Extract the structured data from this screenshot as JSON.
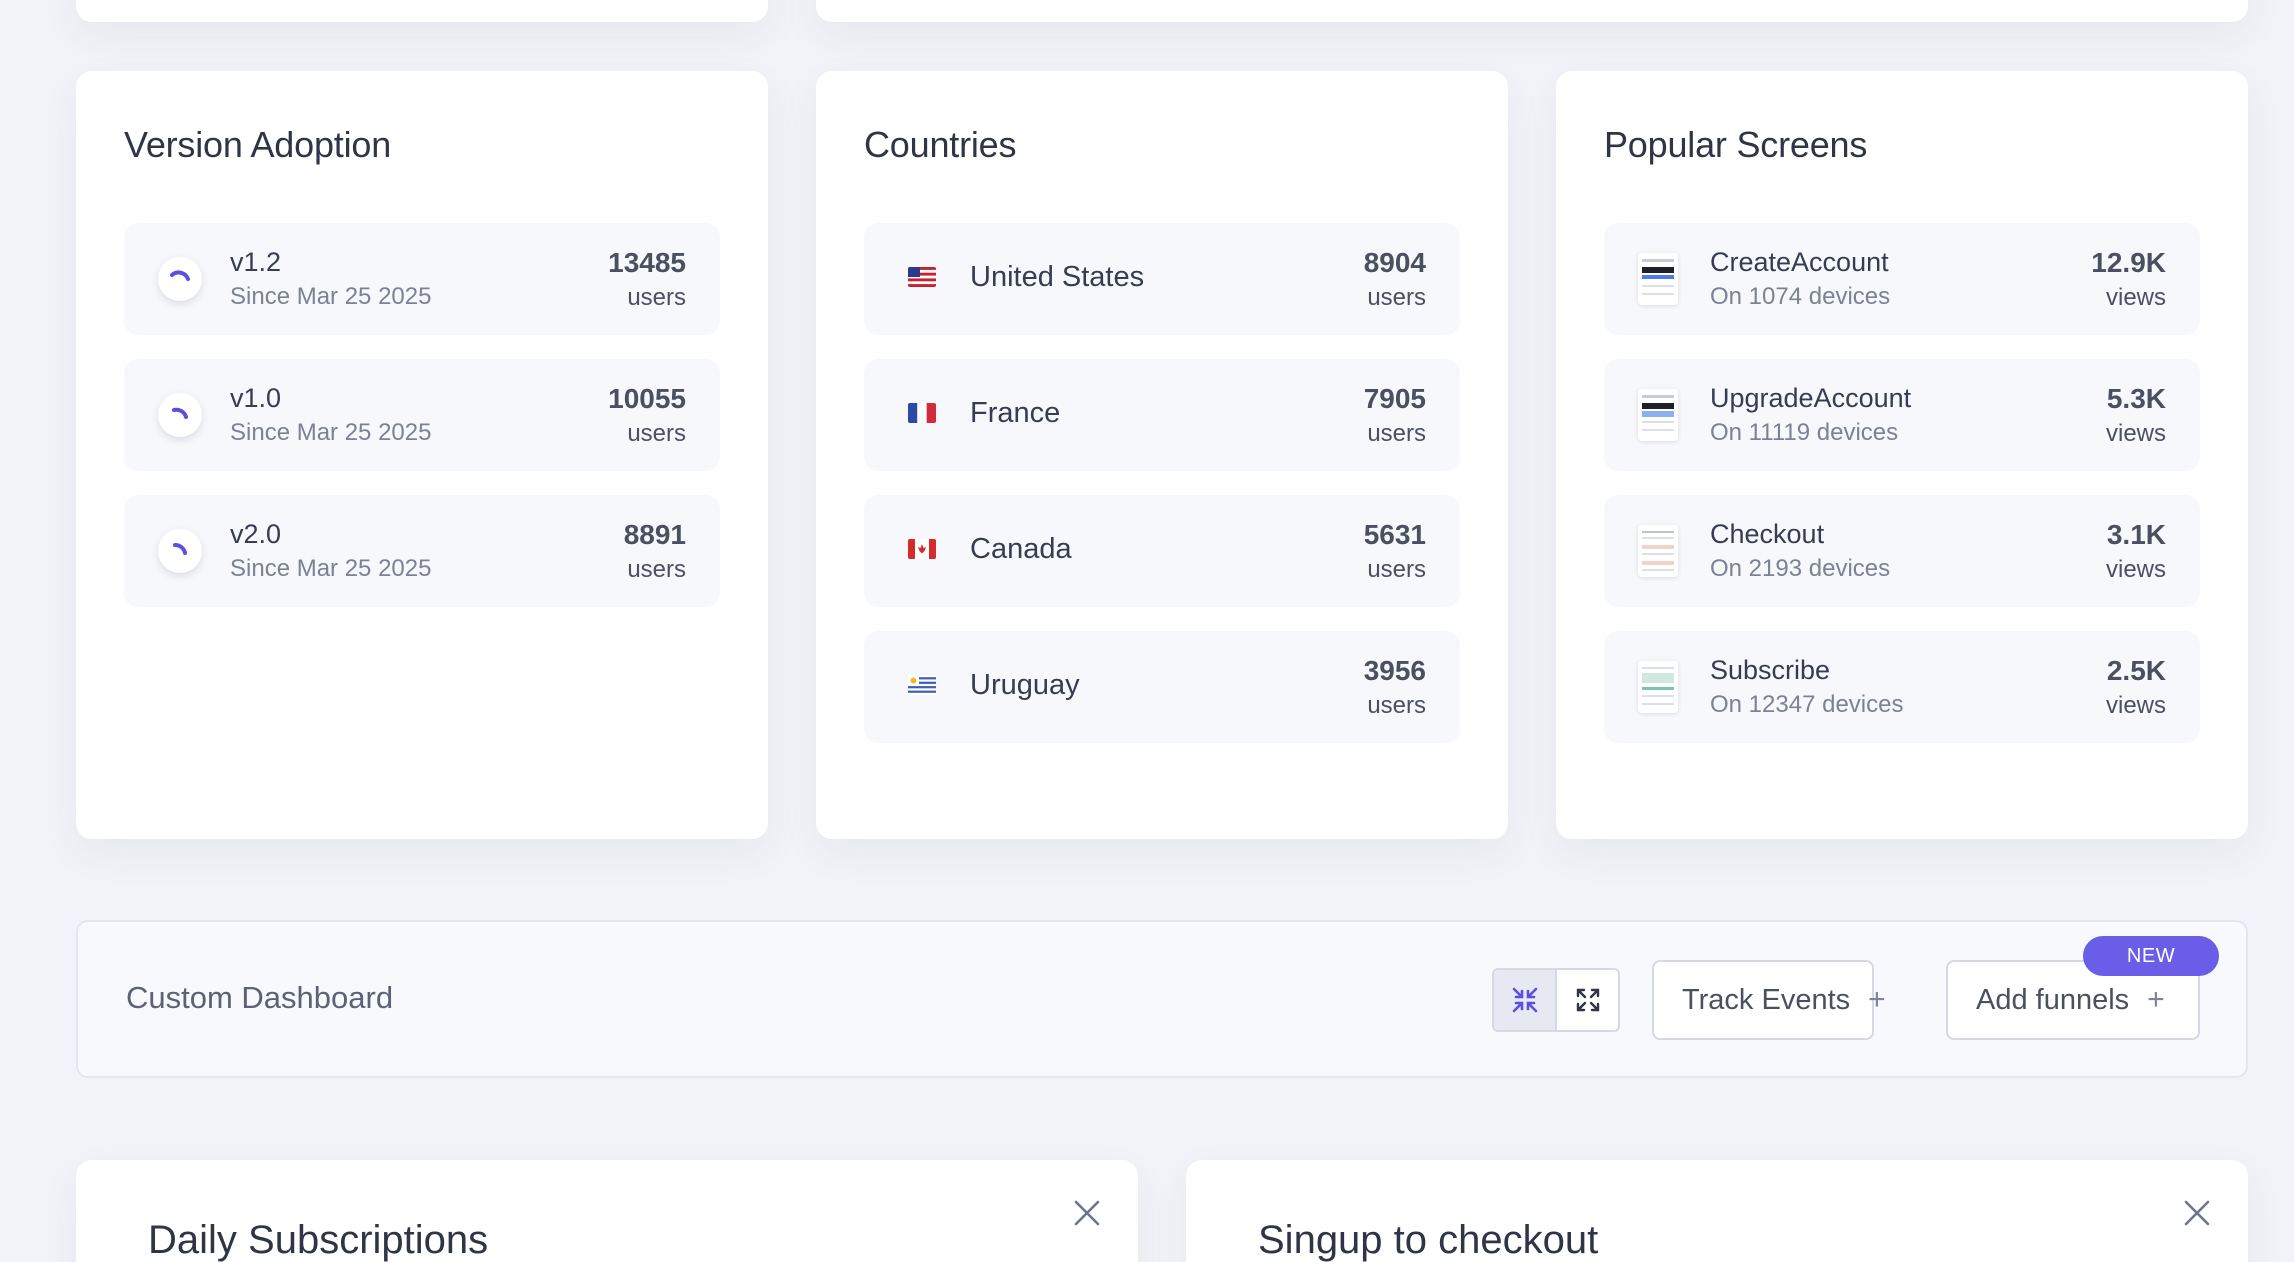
{
  "panels": {
    "versions": {
      "title": "Version Adoption",
      "items": [
        {
          "name": "v1.2",
          "sub": "Since Mar 25 2025",
          "value": "13485",
          "unit": "users"
        },
        {
          "name": "v1.0",
          "sub": "Since Mar 25 2025",
          "value": "10055",
          "unit": "users"
        },
        {
          "name": "v2.0",
          "sub": "Since Mar 25 2025",
          "value": "8891",
          "unit": "users"
        }
      ]
    },
    "countries": {
      "title": "Countries",
      "items": [
        {
          "name": "United States",
          "flag": "us-flag-icon",
          "value": "8904",
          "unit": "users"
        },
        {
          "name": "France",
          "flag": "fr-flag-icon",
          "value": "7905",
          "unit": "users"
        },
        {
          "name": "Canada",
          "flag": "ca-flag-icon",
          "value": "5631",
          "unit": "users"
        },
        {
          "name": "Uruguay",
          "flag": "uy-flag-icon",
          "value": "3956",
          "unit": "users"
        }
      ]
    },
    "screens": {
      "title": "Popular Screens",
      "items": [
        {
          "name": "CreateAccount",
          "sub": "On 1074 devices",
          "value": "12.9K",
          "unit": "views"
        },
        {
          "name": "UpgradeAccount",
          "sub": "On 11119 devices",
          "value": "5.3K",
          "unit": "views"
        },
        {
          "name": "Checkout",
          "sub": "On 2193 devices",
          "value": "3.1K",
          "unit": "views"
        },
        {
          "name": "Subscribe",
          "sub": "On 12347 devices",
          "value": "2.5K",
          "unit": "views"
        }
      ]
    }
  },
  "dashboard": {
    "title": "Custom Dashboard",
    "track_events_label": "Track Events",
    "add_funnels_label": "Add funnels",
    "new_badge": "NEW",
    "plus": "+"
  },
  "bottom_cards": [
    {
      "title": "Daily Subscriptions"
    },
    {
      "title": "Singup to checkout"
    }
  ],
  "colors": {
    "accent": "#5b4fe0",
    "badge": "#6a5de7",
    "background": "#f1f3f8"
  }
}
